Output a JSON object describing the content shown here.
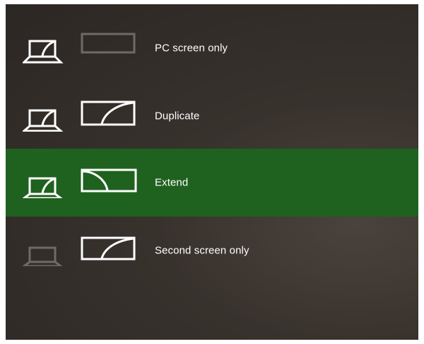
{
  "projection_menu": {
    "options": [
      {
        "label": "PC screen only",
        "icon": "pc-screen-only-icon",
        "selected": false
      },
      {
        "label": "Duplicate",
        "icon": "duplicate-icon",
        "selected": false
      },
      {
        "label": "Extend",
        "icon": "extend-icon",
        "selected": true
      },
      {
        "label": "Second screen only",
        "icon": "second-screen-only-icon",
        "selected": false
      }
    ]
  },
  "colors": {
    "selected_background": "#1f611f",
    "panel_background": "#38322d",
    "active_stroke": "#ffffff",
    "inactive_stroke": "#6f6a66"
  }
}
